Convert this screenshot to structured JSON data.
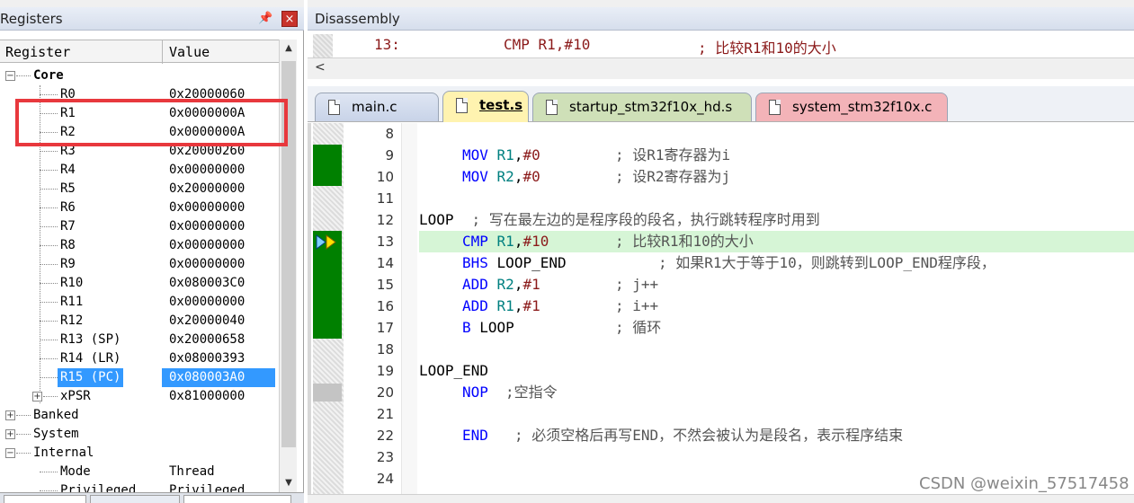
{
  "registers": {
    "title": "Registers",
    "pin": "ㅁ",
    "close": "×",
    "col_register": "Register",
    "col_value": "Value",
    "core_label": "Core",
    "rows": [
      {
        "name": "R0",
        "value": "0x20000060"
      },
      {
        "name": "R1",
        "value": "0x0000000A"
      },
      {
        "name": "R2",
        "value": "0x0000000A"
      },
      {
        "name": "R3",
        "value": "0x20000260"
      },
      {
        "name": "R4",
        "value": "0x00000000"
      },
      {
        "name": "R5",
        "value": "0x20000000"
      },
      {
        "name": "R6",
        "value": "0x00000000"
      },
      {
        "name": "R7",
        "value": "0x00000000"
      },
      {
        "name": "R8",
        "value": "0x00000000"
      },
      {
        "name": "R9",
        "value": "0x00000000"
      },
      {
        "name": "R10",
        "value": "0x080003C0"
      },
      {
        "name": "R11",
        "value": "0x00000000"
      },
      {
        "name": "R12",
        "value": "0x20000040"
      },
      {
        "name": "R13 (SP)",
        "value": "0x20000658"
      },
      {
        "name": "R14 (LR)",
        "value": "0x08000393"
      },
      {
        "name": "R15 (PC)",
        "value": "0x080003A0"
      },
      {
        "name": "xPSR",
        "value": "0x81000000"
      }
    ],
    "banked_label": "Banked",
    "system_label": "System",
    "internal_label": "Internal",
    "mode_label": "Mode",
    "mode_value": "Thread",
    "privilege_label": "Privileged",
    "privilege_value": "Privileged"
  },
  "disassembly": {
    "title": "Disassembly",
    "line_no": "13:",
    "instr": "CMP R1,#10",
    "comment": "; 比较R1和10的大小",
    "scroll_left": "<"
  },
  "tabs": [
    {
      "label": "main.c"
    },
    {
      "label": "test.s"
    },
    {
      "label": "startup_stm32f10x_hd.s"
    },
    {
      "label": "system_stm32f10x.c"
    }
  ],
  "code": [
    {
      "n": "8",
      "text": ""
    },
    {
      "n": "9",
      "op": "MOV",
      "args": [
        "R1",
        "#0"
      ],
      "comment": "; 设R1寄存器为i"
    },
    {
      "n": "10",
      "op": "MOV",
      "args": [
        "R2",
        "#0"
      ],
      "comment": "; 设R2寄存器为j"
    },
    {
      "n": "11",
      "text": ""
    },
    {
      "n": "12",
      "label": "LOOP",
      "comment": "; 写在最左边的是程序段的段名，执行跳转程序时用到"
    },
    {
      "n": "13",
      "op": "CMP",
      "args": [
        "R1",
        "#10"
      ],
      "comment": "; 比较R1和10的大小"
    },
    {
      "n": "14",
      "op": "BHS",
      "target": "LOOP_END",
      "comment": "; 如果R1大于等于10，则跳转到LOOP_END程序段，"
    },
    {
      "n": "15",
      "op": "ADD",
      "args": [
        "R2",
        "#1"
      ],
      "comment": "; j++"
    },
    {
      "n": "16",
      "op": "ADD",
      "args": [
        "R1",
        "#1"
      ],
      "comment": "; i++"
    },
    {
      "n": "17",
      "op": "B",
      "target": "LOOP",
      "comment": "; 循环"
    },
    {
      "n": "18",
      "text": ""
    },
    {
      "n": "19",
      "label": "LOOP_END"
    },
    {
      "n": "20",
      "op": "NOP",
      "comment": ";空指令"
    },
    {
      "n": "21",
      "text": ""
    },
    {
      "n": "22",
      "op": "END",
      "comment": "; 必须空格后再写END，不然会被认为是段名，表示程序结束"
    },
    {
      "n": "23",
      "text": ""
    },
    {
      "n": "24",
      "text": ""
    }
  ],
  "watermark": "CSDN @weixin_57517458",
  "colors": {
    "keyword": "#0000ff",
    "register": "#008080",
    "number": "#8b1a1a",
    "coverage": "#008000",
    "current_line": "#d6f5d6",
    "highlight_box": "#e8383d",
    "selection": "#3399ff"
  }
}
